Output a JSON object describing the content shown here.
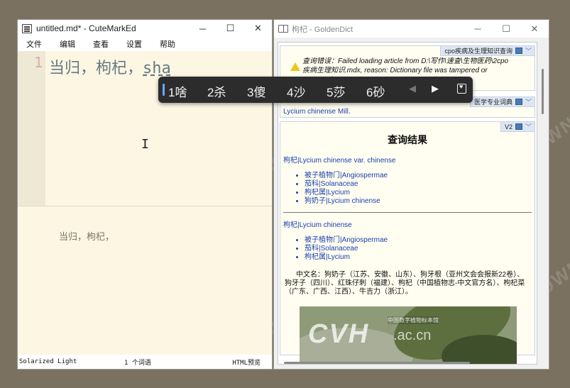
{
  "left_window": {
    "title": "untitled.md* - CuteMarkEd",
    "menu": [
      "文件",
      "编辑",
      "查看",
      "设置",
      "帮助"
    ],
    "line_number": "1",
    "editor_text": "当归，枸杞，",
    "preedit_text": "sha",
    "preview_text": "当归，枸杞，",
    "status": {
      "theme": "Solarized Light",
      "word_count": "1 个词语",
      "html_preview": "HTML预览"
    },
    "controls": {
      "minimize": "─",
      "maximize": "☐",
      "close": "✕"
    }
  },
  "ime": {
    "candidates": [
      "1啥",
      "2杀",
      "3傻",
      "4沙",
      "5莎",
      "6砂"
    ],
    "prev": "◀",
    "next": "▶",
    "favorite_icon": "favorite-icon"
  },
  "right_window": {
    "title": "枸杞 - GoldenDict",
    "controls": {
      "minimize": "─",
      "maximize": "☐",
      "close": "✕"
    },
    "articles": [
      {
        "dict_name": "cpo疾病及生理知识查询",
        "error_text": "查询错误：Failed loading article from D:\\写作\\速查\\生物医药\\2cpo疾病生理知识.mdx, reason: Dictionary file was tampered or corrupted"
      },
      {
        "dict_name": "医学专业词典",
        "word": "Lycium chinense Mill."
      },
      {
        "dict_name": "V2",
        "result_title": "查询结果",
        "block1": {
          "head": "枸杞|Lycium chinense var. chinense",
          "items": [
            "被子植物门|Angiospermae",
            "茄科|Solanaceae",
            "枸杞属|Lycium",
            "狗奶子|Lycium chinense"
          ]
        },
        "block2": {
          "head": "枸杞|Lycium chinense",
          "items": [
            "被子植物门|Angiospermae",
            "茄科|Solanaceae",
            "枸杞属|Lycium"
          ],
          "description": "中文名：狗奶子（江苏、安徽、山东）、狗牙根（亚州文会会报新22卷）、狗牙子（四川）、红珠仔刺（福建）、枸杞（中国植物志-中文官方名）、枸杞菜（广东、广西、江西）、牛吉力（浙江）。"
        },
        "image_text": {
          "logo": "CVH",
          "domain": ".ac.cn",
          "caption": "中国数字植物标本馆"
        }
      }
    ]
  },
  "watermark": "WWW.WEIDOWN.COM"
}
